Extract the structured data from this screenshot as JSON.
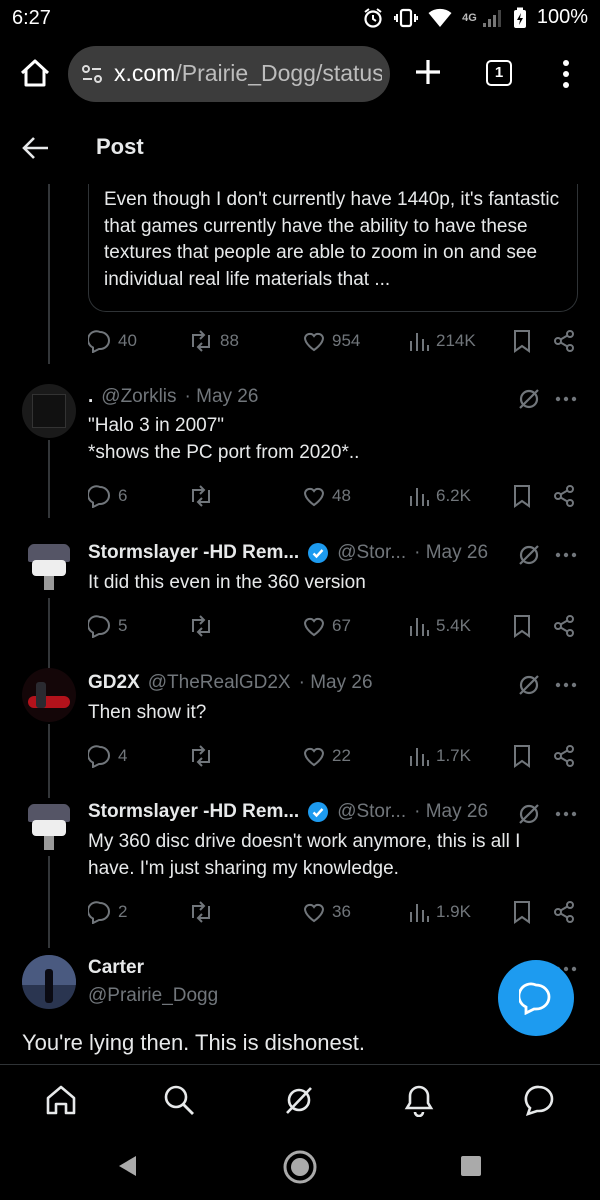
{
  "status_bar": {
    "time": "6:27",
    "network": "4G",
    "battery": "100%"
  },
  "browser": {
    "url_host": "x.com",
    "url_path": "/Prairie_Dogg/status",
    "tab_count": "1"
  },
  "header": {
    "title": "Post"
  },
  "quoted_text": "Even though I don't currently have 1440p, it's fantastic that games currently have the ability to have these textures that people are able to zoom in on and see individual real life materials that ...",
  "main_actions": {
    "replies": "40",
    "reposts": "88",
    "likes": "954",
    "views": "214K"
  },
  "tweets": [
    {
      "name": ".",
      "handle": "@Zorklis",
      "date": "· May 26",
      "text_line1": "\"Halo 3 in 2007\"",
      "text_line2": "*shows the PC port from 2020*..",
      "replies": "6",
      "reposts": "",
      "likes": "48",
      "views": "6.2K"
    },
    {
      "name": "Stormslayer -HD Rem...",
      "handle": "@Stor...",
      "date": "· May 26",
      "text": "It did this even in the 360 version",
      "replies": "5",
      "reposts": "",
      "likes": "67",
      "views": "5.4K"
    },
    {
      "name": "GD2X",
      "handle": "@TheRealGD2X",
      "date": "· May 26",
      "text": "Then show it?",
      "replies": "4",
      "reposts": "",
      "likes": "22",
      "views": "1.7K"
    },
    {
      "name": "Stormslayer -HD Rem...",
      "handle": "@Stor...",
      "date": "· May 26",
      "text": "My 360 disc drive doesn't work anymore, this is all I have. I'm just sharing my knowledge.",
      "replies": "2",
      "reposts": "",
      "likes": "36",
      "views": "1.9K"
    }
  ],
  "main_post": {
    "name": "Carter",
    "handle": "@Prairie_Dogg",
    "text": "You're lying then. This is dishonest."
  },
  "colors": {
    "accent": "#1d9bf0",
    "muted": "#71767b",
    "divider": "#2f3336",
    "text": "#e7e9ea"
  }
}
